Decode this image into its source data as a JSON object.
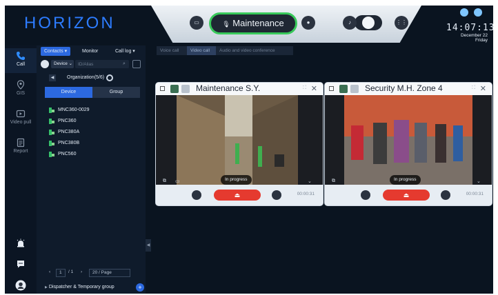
{
  "brand": {
    "logo": "HORIZON",
    "accent": "#2d7cff"
  },
  "rail": {
    "items": [
      {
        "label": "Call",
        "icon": "phone-icon",
        "active": true
      },
      {
        "label": "GIS",
        "icon": "map-pin-icon",
        "active": false
      },
      {
        "label": "Video pull",
        "icon": "video-icon",
        "active": false
      },
      {
        "label": "Report",
        "icon": "report-icon",
        "active": false
      }
    ]
  },
  "header": {
    "active_call_label": "Maintenance",
    "mic_glyph": "🎙"
  },
  "clock": {
    "time": "14:07:13",
    "date": "December 22",
    "weekday": "Friday"
  },
  "contacts": {
    "tabs": [
      {
        "label": "Contacts ▾"
      },
      {
        "label": "Monitor"
      },
      {
        "label": "Call log ▾"
      }
    ],
    "device_select": "Device ⌄",
    "search_placeholder": "ID/Alias",
    "org_label": "Organization(5/6)",
    "segments": [
      {
        "label": "Device"
      },
      {
        "label": "Group"
      }
    ],
    "devices": [
      "MNC360-0029",
      "PNC360",
      "PNC380A",
      "PNC380B",
      "PNC560"
    ],
    "pager": {
      "page": "1",
      "total": "/ 1",
      "prev": "‹",
      "next": "›",
      "page_size": "20 / Page"
    },
    "dispatcher_group": "Dispatcher & Temporary group"
  },
  "call_tabs": [
    {
      "label": "Voice call"
    },
    {
      "label": "Video call"
    },
    {
      "label": "Audio and video conference"
    }
  ],
  "cards": [
    {
      "title": "Maintenance S.Y.",
      "status": "In progress",
      "timer": "00:00:31"
    },
    {
      "title": "Security M.H. Zone 4",
      "status": "In progress",
      "timer": "00:00:31"
    }
  ],
  "colors": {
    "active_green": "#38c95a",
    "hangup_red": "#e53a2f",
    "primary_blue": "#2c69e0"
  }
}
